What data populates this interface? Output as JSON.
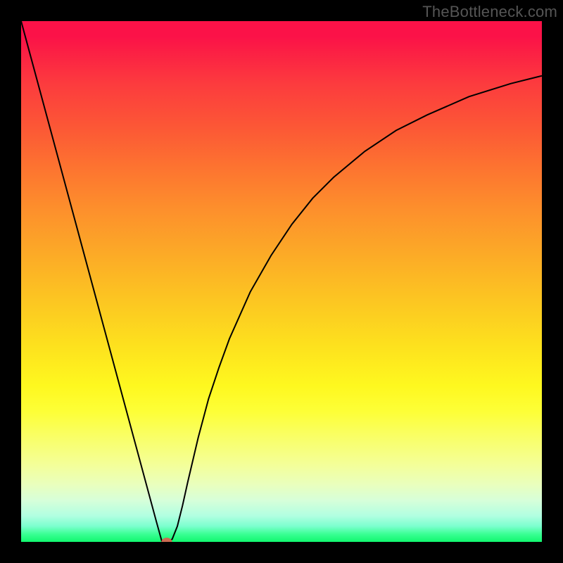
{
  "watermark": "TheBottleneck.com",
  "chart_data": {
    "type": "line",
    "title": "",
    "xlabel": "",
    "ylabel": "",
    "xlim": [
      0,
      100
    ],
    "ylim": [
      0,
      100
    ],
    "grid": false,
    "legend": false,
    "series": [
      {
        "name": "curve",
        "color": "#000000",
        "x": [
          0,
          2,
          4,
          6,
          8,
          10,
          12,
          14,
          16,
          18,
          20,
          22,
          24,
          26,
          27,
          28,
          29,
          30,
          31,
          32,
          34,
          36,
          38,
          40,
          44,
          48,
          52,
          56,
          60,
          66,
          72,
          78,
          86,
          94,
          100
        ],
        "y": [
          100,
          92.6,
          85.2,
          77.8,
          70.4,
          63,
          55.6,
          48.2,
          40.8,
          33.4,
          26,
          18.6,
          11.2,
          3.8,
          0.2,
          0,
          0.5,
          3,
          7,
          11.5,
          20,
          27.5,
          33.5,
          39,
          48,
          55,
          61,
          66,
          70,
          75,
          79,
          82,
          85.5,
          88,
          89.5
        ]
      }
    ],
    "marker": {
      "x": 28,
      "y": 0,
      "color": "#cc6b52"
    },
    "background_gradient": {
      "direction": "vertical",
      "stops": [
        {
          "pos": 0.0,
          "color": "#fb1248"
        },
        {
          "pos": 0.3,
          "color": "#fd7330"
        },
        {
          "pos": 0.55,
          "color": "#fcc422"
        },
        {
          "pos": 0.75,
          "color": "#fdff37"
        },
        {
          "pos": 0.92,
          "color": "#d7ffd9"
        },
        {
          "pos": 1.0,
          "color": "#11f76e"
        }
      ]
    }
  }
}
